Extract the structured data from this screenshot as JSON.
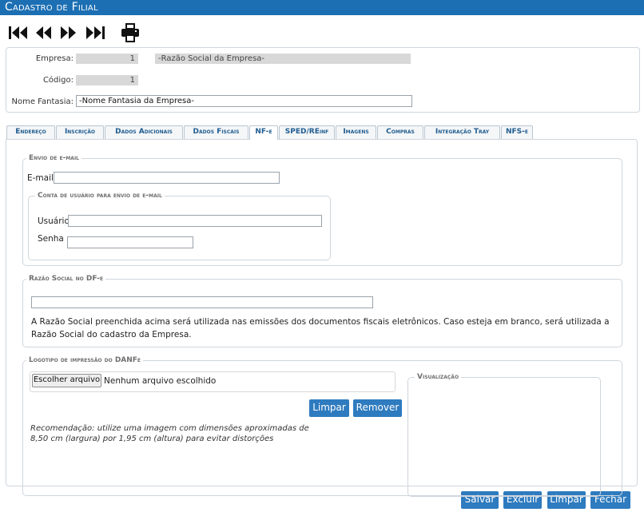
{
  "window": {
    "title": "Cadastro de Filial"
  },
  "nav": {
    "first": "first-record-icon",
    "prev": "previous-record-icon",
    "next": "next-record-icon",
    "last": "last-record-icon",
    "print": "print-icon"
  },
  "header": {
    "empresa_label": "Empresa:",
    "empresa_value": "1",
    "razao_social": "-Razão Social da Empresa-",
    "codigo_label": "Código:",
    "codigo_value": "1",
    "nome_fantasia_label": "Nome Fantasia:",
    "nome_fantasia_value": "-Nome Fantasia da Empresa-"
  },
  "tabs": [
    {
      "label": "Endereço"
    },
    {
      "label": "Inscrição"
    },
    {
      "label": "Dados Adicionais"
    },
    {
      "label": "Dados Fiscais"
    },
    {
      "label": "NF-e",
      "active": true
    },
    {
      "label": "SPED/REinf"
    },
    {
      "label": "Imagens"
    },
    {
      "label": "Compras"
    },
    {
      "label": "Integração Tray"
    },
    {
      "label": "NFS-e"
    }
  ],
  "email_section": {
    "legend": "Envio de e-mail",
    "email_label": "E-mail",
    "email_value": "",
    "account": {
      "legend": "Conta de usuário para envio de e-mail",
      "user_label": "Usuário",
      "user_value": "",
      "password_label": "Senha",
      "password_value": ""
    }
  },
  "razao_section": {
    "legend": "Razão Social no DF-e",
    "value": "",
    "info": "A Razão Social preenchida acima será utilizada nas emissões dos documentos fiscais eletrônicos. Caso esteja em branco, será utilizada a Razão Social do cadastro da Empresa."
  },
  "logo_section": {
    "legend": "Logotipo de impressão do DANFe",
    "choose_file": "Escolher arquivo",
    "no_file": "Nenhum arquivo escolhido",
    "clear": "Limpar",
    "remove": "Remover",
    "recommendation": "Recomendação: utilize uma imagem com dimensões aproximadas de 8,50 cm (largura) por 1,95 cm (altura) para evitar distorções",
    "preview_legend": "Visualização"
  },
  "footer": {
    "save": "Salvar",
    "delete": "Excluir",
    "clear": "Limpar",
    "close": "Fechar"
  },
  "colors": {
    "accent": "#1c6fb3",
    "button": "#2e7bbf",
    "tab_text": "#1f5c8f"
  }
}
